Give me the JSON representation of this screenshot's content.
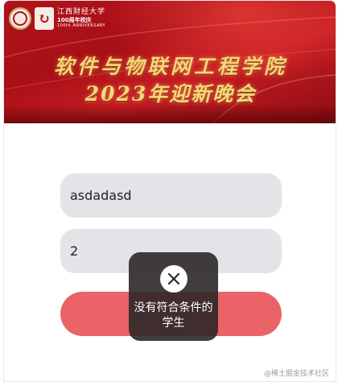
{
  "header": {
    "university_cn": "江西财经大学",
    "anniversary_year": "100周年校庆",
    "anniversary_en": "100th ANNIVERSARY",
    "title_line1": "软件与物联网工程学院",
    "title_line2": "2023年迎新晚会"
  },
  "form": {
    "name_value": "asdadasd",
    "number_value": "2"
  },
  "toast": {
    "icon": "close-icon",
    "message": "没有符合条件的学生"
  },
  "footer": {
    "watermark": "@稀土掘金技术社区"
  },
  "colors": {
    "banner_red": "#b1121a",
    "title_gold": "#f6d77a",
    "input_bg": "#e3e4e7",
    "submit_bg": "#ea6467",
    "toast_bg": "#2e2828"
  }
}
